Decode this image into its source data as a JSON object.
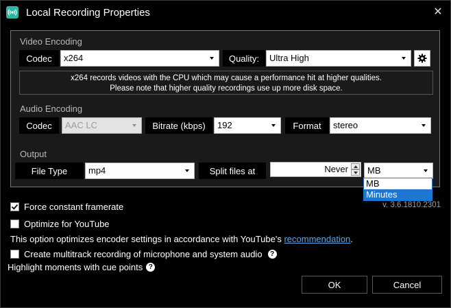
{
  "window": {
    "title": "Local Recording Properties",
    "close_glyph": "✕"
  },
  "video": {
    "section_label": "Video Encoding",
    "codec_label": "Codec",
    "codec_value": "x264",
    "quality_label": "Quality:",
    "quality_value": "Ultra High",
    "info_line1": "x264 records videos with the CPU which may cause a performance hit at higher qualities.",
    "info_line2": "Please note that higher quality recordings use up more disk space."
  },
  "audio": {
    "section_label": "Audio Encoding",
    "codec_label": "Codec",
    "codec_value": "AAC LC",
    "bitrate_label": "Bitrate (kbps)",
    "bitrate_value": "192",
    "format_label": "Format",
    "format_value": "stereo"
  },
  "output": {
    "section_label": "Output",
    "filetype_label": "File Type",
    "filetype_value": "mp4",
    "split_label": "Split files at",
    "split_value": "Never",
    "unit_value": "MB",
    "unit_options": [
      "MB",
      "Minutes"
    ],
    "unit_highlighted": "Minutes"
  },
  "version": "v. 3.6.1810.2301",
  "options": {
    "force_cfr_label": "Force constant framerate",
    "force_cfr_checked": true,
    "youtube_label": "Optimize for YouTube",
    "youtube_checked": false,
    "youtube_desc_prefix": "This option optimizes encoder settings in accordance with YouTube's ",
    "youtube_desc_link": "recommendation",
    "youtube_desc_suffix": ".",
    "multitrack_label": "Create multitrack recording of microphone and system audio",
    "multitrack_checked": false,
    "cue_label": "Highlight moments with cue points",
    "help_glyph": "?"
  },
  "buttons": {
    "ok": "OK",
    "cancel": "Cancel"
  },
  "colors": {
    "accent": "#2fb5a0",
    "selection": "#1c76d2",
    "link": "#5ea5e8"
  }
}
